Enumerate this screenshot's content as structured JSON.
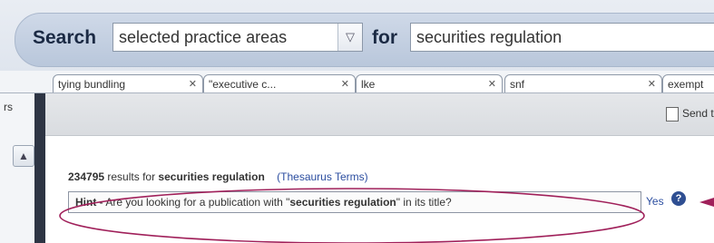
{
  "search": {
    "label": "Search",
    "scope_value": "selected practice areas",
    "for_label": "for",
    "query_value": "securities regulation"
  },
  "tabs": [
    {
      "label": "tying bundling",
      "close": "✕"
    },
    {
      "label": "\"executive c...",
      "close": "✕"
    },
    {
      "label": "lke",
      "close": "✕"
    },
    {
      "label": "snf",
      "close": "✕"
    },
    {
      "label": "exempt",
      "close": ""
    }
  ],
  "sidebar": {
    "label": "rs",
    "scroll_up_icon": "▲"
  },
  "toolbar": {
    "send_label": "Send to T"
  },
  "results": {
    "count": "234795",
    "mid": "results for",
    "query": "securities regulation",
    "thesaurus_link": "(Thesaurus Terms)"
  },
  "hint": {
    "prefix": "Hint",
    "text_before": " - Are you looking for a publication with \"",
    "emph": "securities regulation",
    "text_after": "\" in its title?",
    "yes_label": "Yes",
    "help_icon": "?"
  },
  "colors": {
    "annotation": "#a0205a",
    "link": "#2c4ea0"
  }
}
